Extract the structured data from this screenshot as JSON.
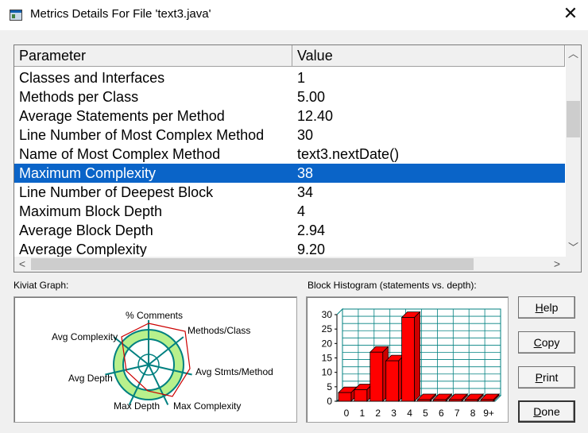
{
  "window": {
    "title": "Metrics Details For File 'text3.java'"
  },
  "table": {
    "headers": [
      "Parameter",
      "Value"
    ],
    "rows": [
      [
        "Classes and Interfaces",
        "1"
      ],
      [
        "Methods per Class",
        "5.00"
      ],
      [
        "Average Statements per Method",
        "12.40"
      ],
      [
        "Line Number of Most Complex Method",
        "30"
      ],
      [
        "Name of Most Complex Method",
        "text3.nextDate()"
      ],
      [
        "Maximum Complexity",
        "38"
      ],
      [
        "Line Number of Deepest Block",
        "34"
      ],
      [
        "Maximum Block Depth",
        "4"
      ],
      [
        "Average Block Depth",
        "2.94"
      ],
      [
        "Average Complexity",
        "9.20"
      ]
    ],
    "selected_index": 5
  },
  "kiviat": {
    "label": "Kiviat Graph:",
    "axes": [
      "% Comments",
      "Methods/Class",
      "Avg Stmts/Method",
      "Max Complexity",
      "Max Depth",
      "Avg Depth",
      "Avg Complexity"
    ]
  },
  "histogram": {
    "label": "Block Histogram (statements vs. depth):"
  },
  "buttons": {
    "help": {
      "pre": "",
      "key": "H",
      "post": "elp"
    },
    "copy": {
      "pre": "",
      "key": "C",
      "post": "opy"
    },
    "print": {
      "pre": "",
      "key": "P",
      "post": "rint"
    },
    "done": {
      "pre": "",
      "key": "D",
      "post": "one"
    }
  },
  "colors": {
    "selection": "#0a64c8",
    "bars": "#ff0000",
    "grid": "#008080",
    "kiviat_ring": "#b8f08c"
  },
  "chart_data": {
    "type": "bar",
    "categories": [
      "0",
      "1",
      "2",
      "3",
      "4",
      "5",
      "6",
      "7",
      "8",
      "9+"
    ],
    "values": [
      3,
      4,
      17,
      14,
      29,
      0,
      0,
      0,
      0,
      0
    ],
    "ylim": [
      0,
      30
    ],
    "yticks": [
      "0",
      "5",
      "10",
      "15",
      "20",
      "25",
      "30"
    ]
  }
}
